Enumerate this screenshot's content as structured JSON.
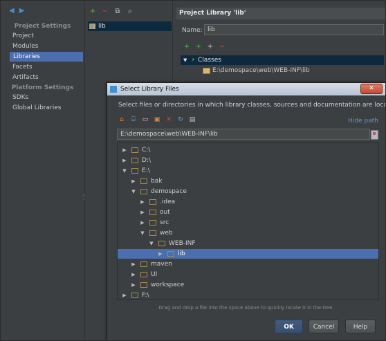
{
  "sidebar": {
    "back_icon": "◆",
    "forward_icon": "◆",
    "project_settings_header": "Project Settings",
    "platform_settings_header": "Platform Settings",
    "items": [
      {
        "label": "Project"
      },
      {
        "label": "Modules"
      },
      {
        "label": "Libraries"
      },
      {
        "label": "Facets"
      },
      {
        "label": "Artifacts"
      },
      {
        "label": "SDKs"
      },
      {
        "label": "Global Libraries"
      }
    ]
  },
  "library_list": {
    "toolbar": {
      "add": "+",
      "remove": "−",
      "copy": "⧉",
      "find": "⌕"
    },
    "items": [
      {
        "label": "lib"
      }
    ]
  },
  "project_library": {
    "title": "Project Library 'lib'",
    "name_label": "Name:",
    "name_value": "lib",
    "toolbar": {
      "add": "+",
      "add_jar": "+",
      "add_folder": "+",
      "remove": "−"
    },
    "classes_label": "Classes",
    "classes_path": "E:\\demospace\\web\\WEB-INF\\lib"
  },
  "dialog": {
    "title": "Select Library Files",
    "close": "✕",
    "description": "Select files or directories in which library classes, sources and documentation are located",
    "hide_path": "Hide path",
    "path_value": "E:\\demospace\\web\\WEB-INF\\lib",
    "tree": [
      {
        "label": "C:\\",
        "expanded": false
      },
      {
        "label": "D:\\",
        "expanded": false
      },
      {
        "label": "E:\\",
        "expanded": true
      },
      {
        "label": "bak",
        "expanded": false
      },
      {
        "label": "demospace",
        "expanded": true
      },
      {
        "label": ".idea",
        "expanded": false
      },
      {
        "label": "out",
        "expanded": false
      },
      {
        "label": "src",
        "expanded": false
      },
      {
        "label": "web",
        "expanded": true
      },
      {
        "label": "WEB-INF",
        "expanded": true
      },
      {
        "label": "lib",
        "expanded": false,
        "selected": true
      },
      {
        "label": "maven",
        "expanded": false
      },
      {
        "label": "UI",
        "expanded": false
      },
      {
        "label": "workspace",
        "expanded": false
      },
      {
        "label": "F:\\",
        "expanded": false
      }
    ],
    "drag_hint": "Drag and drop a file into the space above to quickly locate it in the tree.",
    "ok_label": "OK",
    "cancel_label": "Cancel",
    "help_label": "Help"
  },
  "colors": {
    "selection": "#4b6eaf",
    "accent_link": "#5b95d6",
    "add_icon": "#4fbf4a",
    "remove_icon": "#e2453d"
  }
}
